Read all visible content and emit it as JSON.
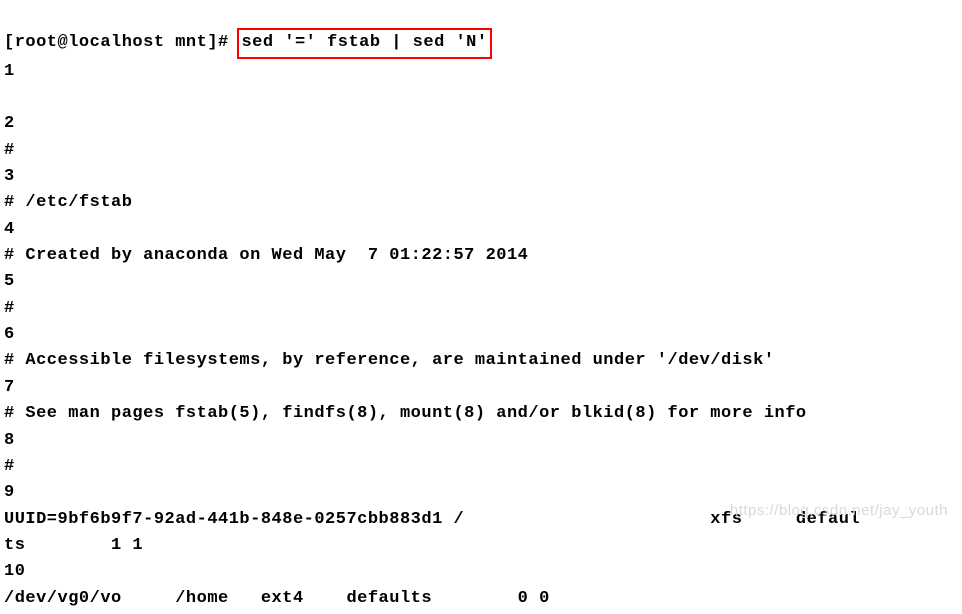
{
  "prompt": {
    "prefix": "[root@localhost mnt]# ",
    "command": "sed '=' fstab | sed 'N'"
  },
  "lines": [
    "1",
    "",
    "2",
    "#",
    "3",
    "# /etc/fstab",
    "4",
    "# Created by anaconda on Wed May  7 01:22:57 2014",
    "5",
    "#",
    "6",
    "# Accessible filesystems, by reference, are maintained under '/dev/disk'",
    "7",
    "# See man pages fstab(5), findfs(8), mount(8) and/or blkid(8) for more info",
    "8",
    "#",
    "9",
    "UUID=9bf6b9f7-92ad-441b-848e-0257cbb883d1 /                       xfs     defaul",
    "ts        1 1",
    "10",
    "/dev/vg0/vo     /home   ext4    defaults        0 0"
  ],
  "watermark": "https://blog.csdn.net/jay_youth"
}
